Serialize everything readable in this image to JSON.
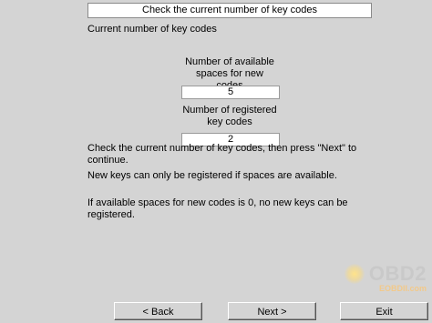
{
  "header": {
    "title": "Check the current number of key codes"
  },
  "main": {
    "heading": "Current number of key codes",
    "available": {
      "label_line1": "Number of available",
      "label_line2": "spaces for new codes",
      "value": "5"
    },
    "registered": {
      "label_line1": "Number of registered",
      "label_line2": "key codes",
      "value": "2"
    },
    "instruction_line1": "Check the current number of key codes, then press \"Next\" to",
    "instruction_line2": "continue.",
    "note1": "New keys can only be registered if spaces are available.",
    "note2_line1": "If available spaces for new codes is 0, no new keys can be",
    "note2_line2": "registered."
  },
  "footer": {
    "back_label": "< Back",
    "next_label": "Next >",
    "exit_label": "Exit"
  },
  "watermark": {
    "main": "OBD2",
    "sub": "EOBDII.com"
  }
}
